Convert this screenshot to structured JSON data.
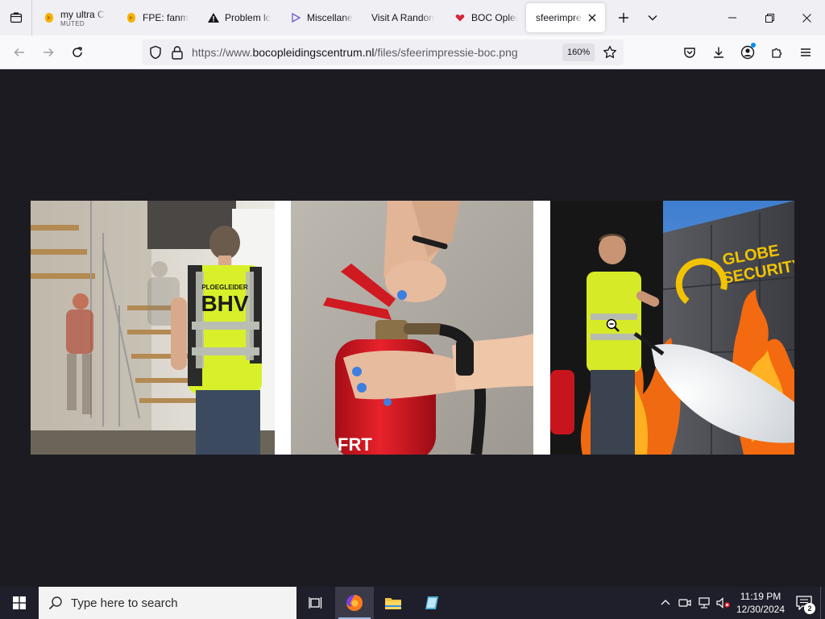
{
  "browser": {
    "tabs": [
      {
        "title": "my ultra C",
        "sub": "MUTED",
        "icon": "speaker-badge-icon"
      },
      {
        "title": "FPE: fanm",
        "icon": "speaker-badge-icon"
      },
      {
        "title": "Problem lo",
        "icon": "warning-icon"
      },
      {
        "title": "Miscellane",
        "icon": "play-icon"
      },
      {
        "title": "Visit A Randon",
        "icon": "none"
      },
      {
        "title": "BOC Oplei",
        "icon": "heart-icon"
      },
      {
        "title": "sfeerimpress",
        "icon": "none",
        "active": true
      }
    ],
    "url_prefix": "https://www.",
    "url_host": "bocopleidingscentrum.nl",
    "url_path": "/files/sfeerimpressie-boc.png",
    "zoom": "160%"
  },
  "image": {
    "panel1": {
      "vest_top": "PLOEGLEIDER",
      "vest_main": "BHV"
    },
    "panel2": {
      "extinguisher_label": "FRT"
    },
    "panel3": {
      "sign_line1": "GLOBE",
      "sign_line2": "SECURITY"
    }
  },
  "taskbar": {
    "search_placeholder": "Type here to search",
    "time": "11:19 PM",
    "date": "12/30/2024",
    "notifications": "2"
  },
  "colors": {
    "content_bg": "#1c1b22",
    "taskbar_bg": "#1f1f2b",
    "accent": "#0060df"
  }
}
